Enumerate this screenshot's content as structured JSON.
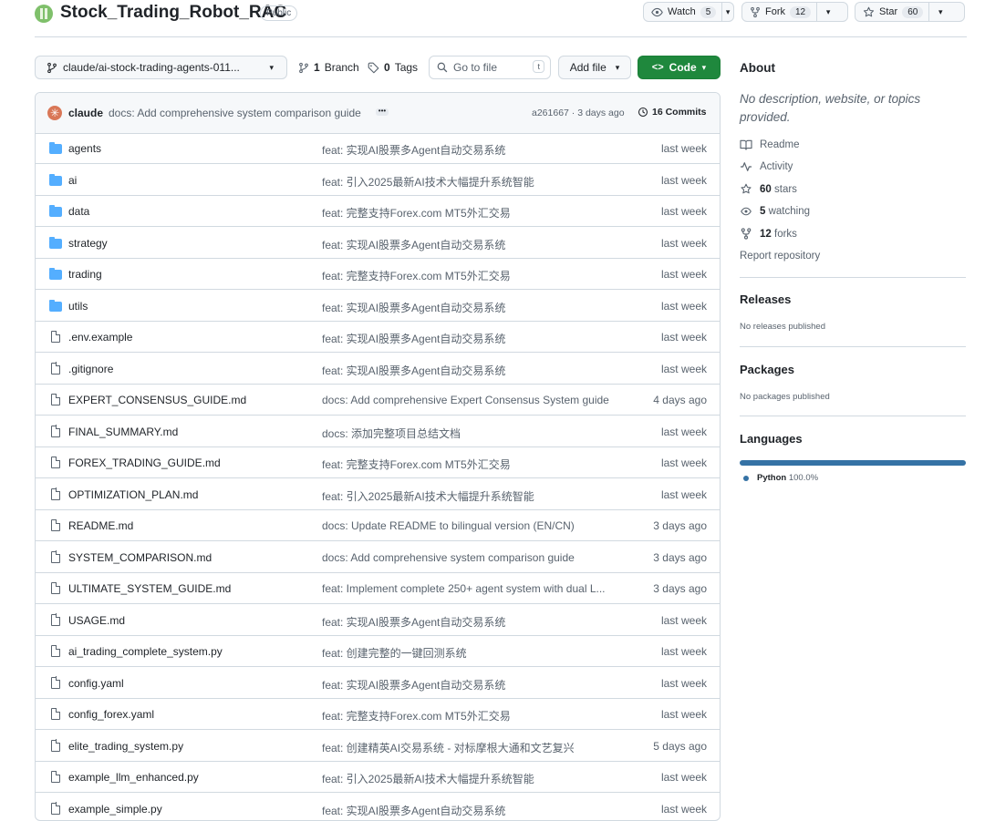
{
  "repo": {
    "name": "Stock_Trading_Robot_RAC",
    "visibility": "Public",
    "watch": {
      "label": "Watch",
      "count": "5"
    },
    "fork": {
      "label": "Fork",
      "count": "12"
    },
    "star": {
      "label": "Star",
      "count": "60"
    }
  },
  "toolbar": {
    "branch": "claude/ai-stock-trading-agents-011...",
    "branches_count": "1",
    "branches_label": "Branch",
    "tags_count": "0",
    "tags_label": "Tags",
    "goto_placeholder": "Go to file",
    "goto_kbd": "t",
    "add_file": "Add file",
    "code": "Code"
  },
  "commit": {
    "author": "claude",
    "message": "docs: Add comprehensive system comparison guide",
    "hash_time": "a261667 · 3 days ago",
    "commits": "16 Commits"
  },
  "files": [
    {
      "name": "agents",
      "type": "dir",
      "message": "feat: 实现AI股票多Agent自动交易系统",
      "date": "last week"
    },
    {
      "name": "ai",
      "type": "dir",
      "message": "feat: 引入2025最新AI技术大幅提升系统智能",
      "date": "last week"
    },
    {
      "name": "data",
      "type": "dir",
      "message": "feat: 完整支持Forex.com MT5外汇交易",
      "date": "last week"
    },
    {
      "name": "strategy",
      "type": "dir",
      "message": "feat: 实现AI股票多Agent自动交易系统",
      "date": "last week"
    },
    {
      "name": "trading",
      "type": "dir",
      "message": "feat: 完整支持Forex.com MT5外汇交易",
      "date": "last week"
    },
    {
      "name": "utils",
      "type": "dir",
      "message": "feat: 实现AI股票多Agent自动交易系统",
      "date": "last week"
    },
    {
      "name": ".env.example",
      "type": "file",
      "message": "feat: 实现AI股票多Agent自动交易系统",
      "date": "last week"
    },
    {
      "name": ".gitignore",
      "type": "file",
      "message": "feat: 实现AI股票多Agent自动交易系统",
      "date": "last week"
    },
    {
      "name": "EXPERT_CONSENSUS_GUIDE.md",
      "type": "file",
      "message": "docs: Add comprehensive Expert Consensus System guide",
      "date": "4 days ago"
    },
    {
      "name": "FINAL_SUMMARY.md",
      "type": "file",
      "message": "docs: 添加完整项目总结文档",
      "date": "last week"
    },
    {
      "name": "FOREX_TRADING_GUIDE.md",
      "type": "file",
      "message": "feat: 完整支持Forex.com MT5外汇交易",
      "date": "last week"
    },
    {
      "name": "OPTIMIZATION_PLAN.md",
      "type": "file",
      "message": "feat: 引入2025最新AI技术大幅提升系统智能",
      "date": "last week"
    },
    {
      "name": "README.md",
      "type": "file",
      "message": "docs: Update README to bilingual version (EN/CN)",
      "date": "3 days ago"
    },
    {
      "name": "SYSTEM_COMPARISON.md",
      "type": "file",
      "message": "docs: Add comprehensive system comparison guide",
      "date": "3 days ago"
    },
    {
      "name": "ULTIMATE_SYSTEM_GUIDE.md",
      "type": "file",
      "message": "feat: Implement complete 250+ agent system with dual L...",
      "date": "3 days ago"
    },
    {
      "name": "USAGE.md",
      "type": "file",
      "message": "feat: 实现AI股票多Agent自动交易系统",
      "date": "last week"
    },
    {
      "name": "ai_trading_complete_system.py",
      "type": "file",
      "message": "feat: 创建完整的一键回测系统",
      "date": "last week"
    },
    {
      "name": "config.yaml",
      "type": "file",
      "message": "feat: 实现AI股票多Agent自动交易系统",
      "date": "last week"
    },
    {
      "name": "config_forex.yaml",
      "type": "file",
      "message": "feat: 完整支持Forex.com MT5外汇交易",
      "date": "last week"
    },
    {
      "name": "elite_trading_system.py",
      "type": "file",
      "message": "feat: 创建精英AI交易系统 - 对标摩根大通和文艺复兴",
      "date": "5 days ago"
    },
    {
      "name": "example_llm_enhanced.py",
      "type": "file",
      "message": "feat: 引入2025最新AI技术大幅提升系统智能",
      "date": "last week"
    },
    {
      "name": "example_simple.py",
      "type": "file",
      "message": "feat: 实现AI股票多Agent自动交易系统",
      "date": "last week"
    }
  ],
  "about": {
    "heading": "About",
    "description": "No description, website, or topics provided.",
    "readme": "Readme",
    "activity": "Activity",
    "stars_num": "60",
    "stars_word": "stars",
    "watching_num": "5",
    "watching_word": "watching",
    "forks_num": "12",
    "forks_word": "forks",
    "report": "Report repository"
  },
  "releases": {
    "heading": "Releases",
    "text": "No releases published"
  },
  "packages": {
    "heading": "Packages",
    "text": "No packages published"
  },
  "languages": {
    "heading": "Languages",
    "name": "Python",
    "percent": "100.0%",
    "share": 1.0,
    "color": "#3572A5"
  }
}
